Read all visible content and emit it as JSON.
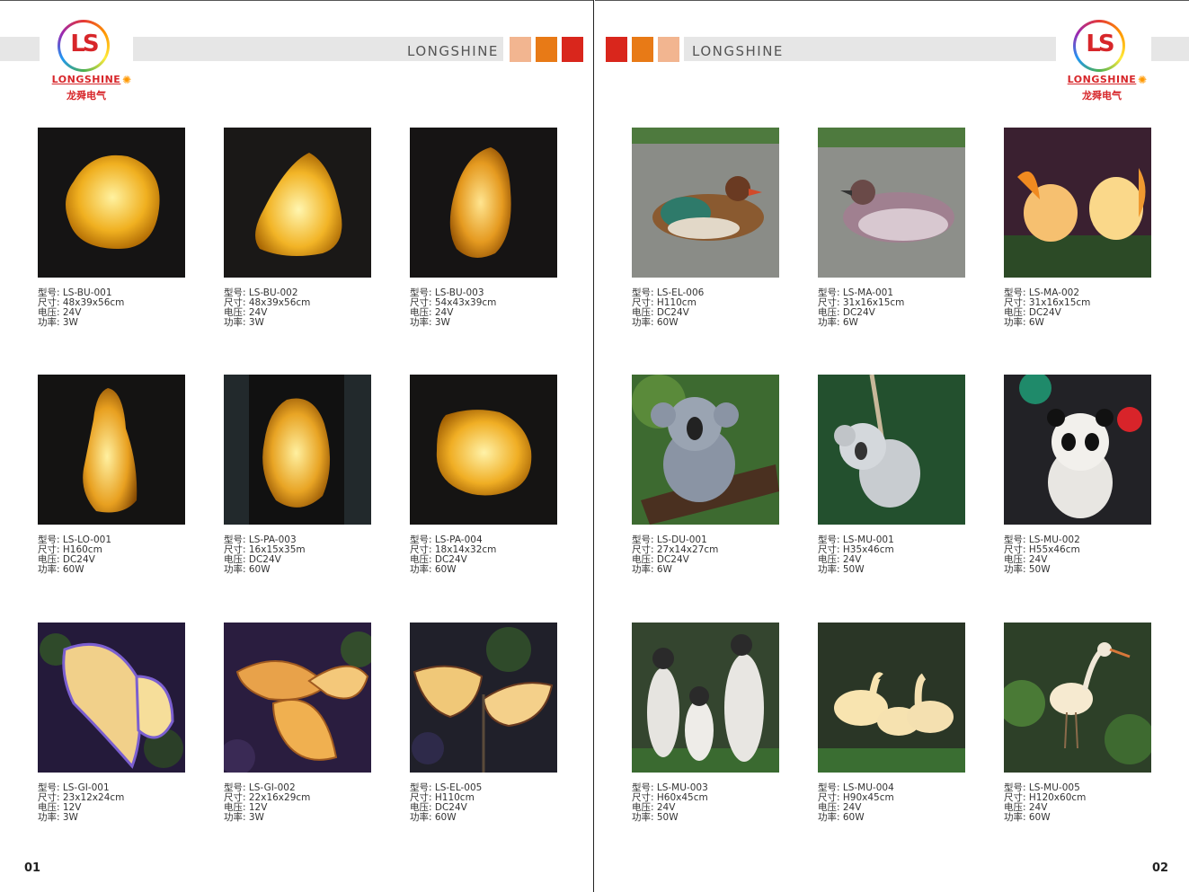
{
  "brand": "LONGSHINE",
  "logo": {
    "monogram": "LS",
    "wordmark": "LONGSHINE",
    "chinese": "龙舜电气"
  },
  "accent_colors": [
    "#f2b590",
    "#e87a16",
    "#d9261c"
  ],
  "pages": [
    {
      "page_number": "01",
      "products": [
        {
          "model": "型号: LS-BU-001",
          "size": "尺寸: 48x39x56cm",
          "voltage": "电压: 24V",
          "power": "功率: 3W",
          "image": "amber rock lamp"
        },
        {
          "model": "型号: LS-BU-002",
          "size": "尺寸: 48x39x56cm",
          "voltage": "电压: 24V",
          "power": "功率: 3W",
          "image": "amber rock lamp"
        },
        {
          "model": "型号: LS-BU-003",
          "size": "尺寸: 54x43x39cm",
          "voltage": "电压: 24V",
          "power": "功率: 3W",
          "image": "amber rock lamp"
        },
        {
          "model": "型号: LS-LO-001",
          "size": "尺寸: H160cm",
          "voltage": "电压: DC24V",
          "power": "功率: 60W",
          "image": "tall rock lamp"
        },
        {
          "model": "型号: LS-PA-003",
          "size": "尺寸: 16x15x35m",
          "voltage": "电压: DC24V",
          "power": "功率: 60W",
          "image": "rock lamp"
        },
        {
          "model": "型号: LS-PA-004",
          "size": "尺寸: 18x14x32cm",
          "voltage": "电压: DC24V",
          "power": "功率: 60W",
          "image": "rock lamp"
        },
        {
          "model": "型号: LS-GI-001",
          "size": "尺寸: 23x12x24cm",
          "voltage": "电压: 12V",
          "power": "功率: 3W",
          "image": "butterfly lamp"
        },
        {
          "model": "型号: LS-GI-002",
          "size": "尺寸: 22x16x29cm",
          "voltage": "电压: 12V",
          "power": "功率: 3W",
          "image": "butterfly lamp"
        },
        {
          "model": "型号: LS-EL-005",
          "size": "尺寸: H110cm",
          "voltage": "电压: DC24V",
          "power": "功率: 60W",
          "image": "butterfly lamp"
        }
      ]
    },
    {
      "page_number": "02",
      "products": [
        {
          "model": "型号: LS-EL-006",
          "size": "尺寸: H110cm",
          "voltage": "电压: DC24V",
          "power": "功率: 60W",
          "image": "mandarin duck"
        },
        {
          "model": "型号: LS-MA-001",
          "size": "尺寸: 31x16x15cm",
          "voltage": "电压: DC24V",
          "power": "功率: 6W",
          "image": "duck"
        },
        {
          "model": "型号: LS-MA-002",
          "size": "尺寸: 31x16x15cm",
          "voltage": "电压: DC24V",
          "power": "功率: 6W",
          "image": "squirrels"
        },
        {
          "model": "型号: LS-DU-001",
          "size": "尺寸: 27x14x27cm",
          "voltage": "电压: DC24V",
          "power": "功率: 6W",
          "image": "koala on swing"
        },
        {
          "model": "型号: LS-MU-001",
          "size": "尺寸: H35x46cm",
          "voltage": "电压: 24V",
          "power": "功率: 50W",
          "image": "koala on rope"
        },
        {
          "model": "型号: LS-MU-002",
          "size": "尺寸: H55x46cm",
          "voltage": "电压: 24V",
          "power": "功率: 50W",
          "image": "panda"
        },
        {
          "model": "型号: LS-MU-003",
          "size": "尺寸: H60x45cm",
          "voltage": "电压: 24V",
          "power": "功率: 50W",
          "image": "penguins"
        },
        {
          "model": "型号: LS-MU-004",
          "size": "尺寸: H90x45cm",
          "voltage": "电压: 24V",
          "power": "功率: 60W",
          "image": "geese"
        },
        {
          "model": "型号: LS-MU-005",
          "size": "尺寸: H120x60cm",
          "voltage": "电压: 24V",
          "power": "功率: 60W",
          "image": "egret"
        }
      ]
    }
  ]
}
